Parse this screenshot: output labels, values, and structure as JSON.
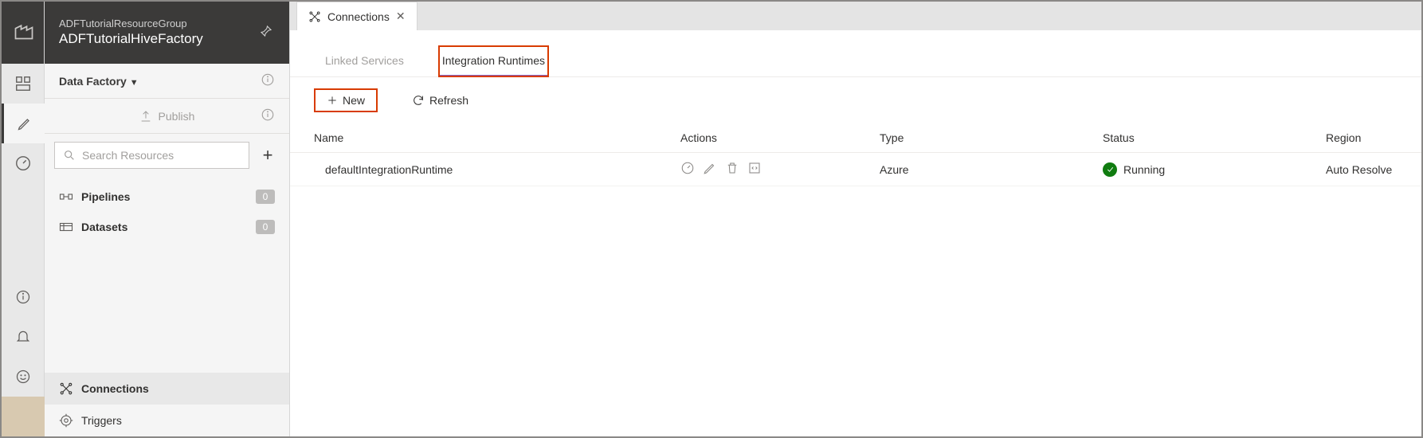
{
  "header": {
    "resource_group": "ADFTutorialResourceGroup",
    "factory_name": "ADFTutorialHiveFactory"
  },
  "sidebar": {
    "scope_label": "Data Factory",
    "publish_label": "Publish",
    "search_placeholder": "Search Resources",
    "tree": {
      "pipelines": {
        "label": "Pipelines",
        "count": "0"
      },
      "datasets": {
        "label": "Datasets",
        "count": "0"
      }
    },
    "bottom": {
      "connections": "Connections",
      "triggers": "Triggers"
    }
  },
  "doc_tab": {
    "title": "Connections"
  },
  "subtabs": {
    "linked": "Linked Services",
    "integration": "Integration Runtimes"
  },
  "toolbar": {
    "new_label": "New",
    "refresh_label": "Refresh"
  },
  "grid": {
    "cols": {
      "name": "Name",
      "actions": "Actions",
      "type": "Type",
      "status": "Status",
      "region": "Region"
    },
    "rows": [
      {
        "name": "defaultIntegrationRuntime",
        "type": "Azure",
        "status": "Running",
        "region": "Auto Resolve"
      }
    ]
  }
}
